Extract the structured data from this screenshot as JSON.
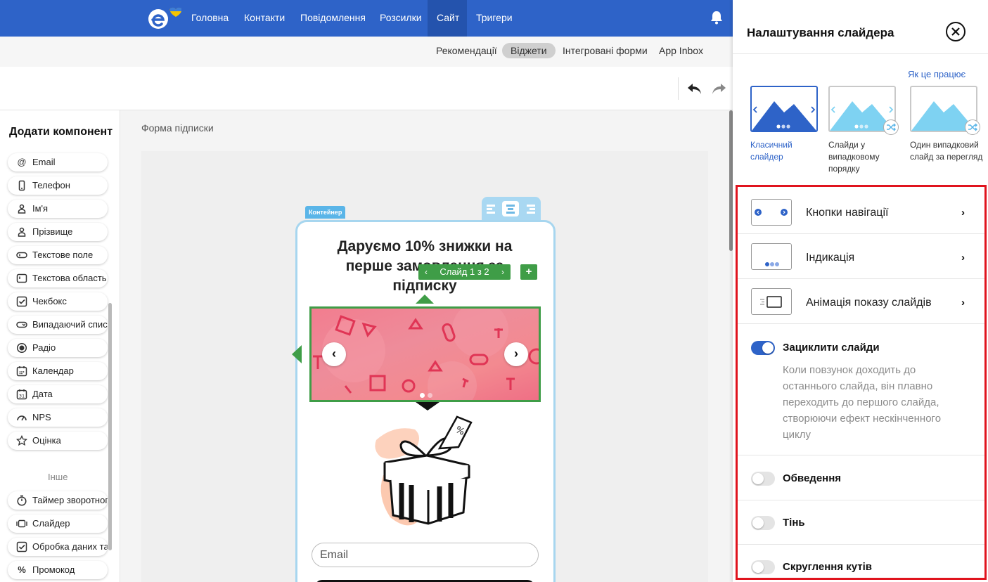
{
  "nav": {
    "items": [
      "Головна",
      "Контакти",
      "Повідомлення",
      "Розсилки",
      "Сайт",
      "Тригери"
    ],
    "active": "Сайт"
  },
  "subnav": {
    "items": [
      "Рекомендації",
      "Віджети",
      "Інтегровані форми",
      "App Inbox"
    ],
    "active": "Віджети"
  },
  "left_panel": {
    "title": "Додати компонент",
    "components": [
      {
        "label": "Email",
        "icon": "at-icon"
      },
      {
        "label": "Телефон",
        "icon": "phone-icon"
      },
      {
        "label": "Ім'я",
        "icon": "person-icon"
      },
      {
        "label": "Прізвище",
        "icon": "person-icon"
      },
      {
        "label": "Текстове поле",
        "icon": "text-field-icon"
      },
      {
        "label": "Текстова область",
        "icon": "text-area-icon"
      },
      {
        "label": "Чекбокс",
        "icon": "checkbox-icon"
      },
      {
        "label": "Випадаючий список",
        "icon": "dropdown-icon"
      },
      {
        "label": "Радіо",
        "icon": "radio-icon"
      },
      {
        "label": "Календар",
        "icon": "calendar-icon"
      },
      {
        "label": "Дата",
        "icon": "date-icon"
      },
      {
        "label": "NPS",
        "icon": "gauge-icon"
      },
      {
        "label": "Оцінка",
        "icon": "star-icon"
      }
    ],
    "other_title": "Інше",
    "other_components": [
      {
        "label": "Таймер зворотного відліку",
        "icon": "timer-icon"
      },
      {
        "label": "Слайдер",
        "icon": "slider-icon"
      },
      {
        "label": "Обробка даних та",
        "icon": "checkbox-icon"
      },
      {
        "label": "Промокод",
        "icon": "percent-icon"
      }
    ]
  },
  "canvas": {
    "title": "Форма підписки",
    "container_tag": "Контейнер",
    "headline": "Даруємо 10% знижки на перше замовлення за підписку",
    "slide_indicator": "Слайд 1 з 2",
    "add_button": "+",
    "email_placeholder": "Email"
  },
  "right_panel": {
    "title": "Налаштування слайдера",
    "how_it_works": "Як це працює",
    "styles": [
      {
        "label": "Класичний слайдер",
        "selected": true
      },
      {
        "label": "Слайди у випадковому порядку",
        "selected": false
      },
      {
        "label": "Один випадковий слайд за перегляд",
        "selected": false
      }
    ],
    "rows": [
      {
        "label": "Кнопки навігації"
      },
      {
        "label": "Індикація"
      },
      {
        "label": "Анімація показу слайдів"
      }
    ],
    "loop": {
      "label": "Зациклити слайди",
      "on": true,
      "description": "Коли повзунок доходить до останнього слайда, він плавно переходить до першого слайда, створюючи ефект нескінченного циклу"
    },
    "outline": {
      "label": "Обведення",
      "on": false
    },
    "shadow": {
      "label": "Тінь",
      "on": false
    },
    "rounding": {
      "label": "Скруглення кутів",
      "on": false
    }
  },
  "colors": {
    "brand": "#2e63c8",
    "editor_green": "#3f9d47",
    "highlight_red": "#e0141e",
    "container_blue": "#5ab5e8"
  }
}
